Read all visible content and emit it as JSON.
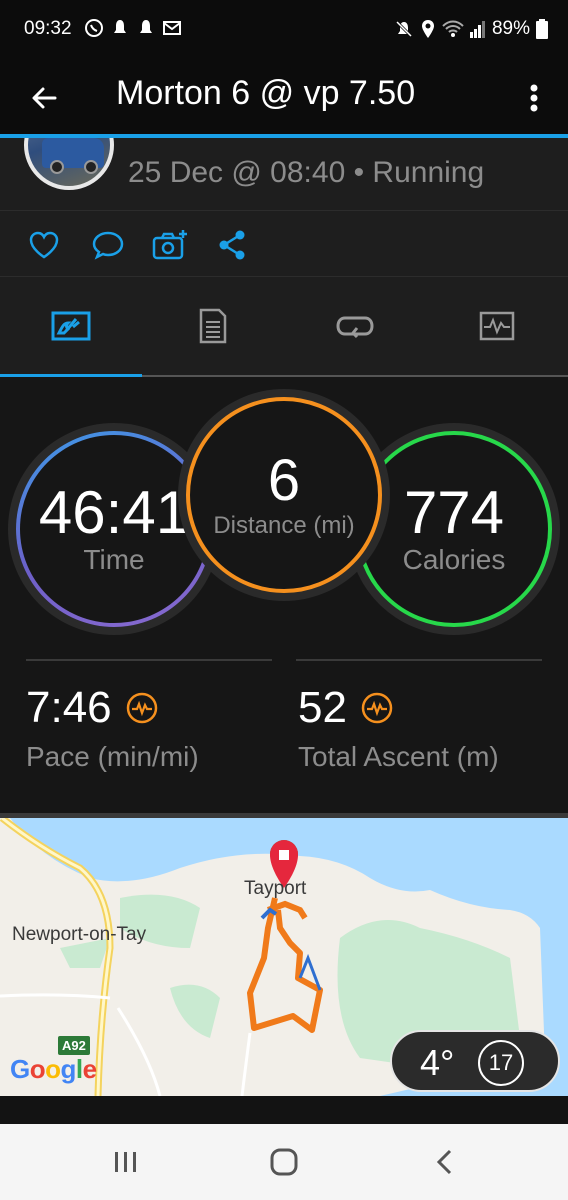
{
  "status_bar": {
    "time": "09:32",
    "battery_percent": "89%",
    "left_icons": [
      "whatsapp-icon",
      "notification-icon",
      "notification-icon",
      "mail-icon"
    ],
    "right_icons": [
      "mute-icon",
      "location-icon",
      "wifi-icon",
      "signal-icon",
      "battery-icon"
    ]
  },
  "app_bar": {
    "title": "Morton 6 @ vp 7.50",
    "back_icon": "arrow-back-icon",
    "menu_icon": "more-vertical-icon"
  },
  "activity": {
    "meta": "25 Dec @ 08:40 • Running"
  },
  "actions": [
    "like-icon",
    "comment-icon",
    "add-photo-icon",
    "share-icon"
  ],
  "tabs": [
    {
      "icon": "overview-icon",
      "active": true
    },
    {
      "icon": "details-icon",
      "active": false
    },
    {
      "icon": "laps-icon",
      "active": false
    },
    {
      "icon": "charts-icon",
      "active": false
    }
  ],
  "stats": {
    "time": {
      "value": "46:41",
      "label": "Time"
    },
    "distance": {
      "value": "6",
      "label": "Distance (mi)"
    },
    "calories": {
      "value": "774",
      "label": "Calories"
    },
    "pace": {
      "value": "7:46",
      "label": "Pace (min/mi)"
    },
    "ascent": {
      "value": "52",
      "label": "Total Ascent (m)"
    }
  },
  "map": {
    "labels": {
      "town1": "Tayport",
      "town2": "Newport-on-Tay",
      "road": "A92",
      "brand": "Google"
    },
    "weather": {
      "temp": "4°",
      "wind": "17"
    }
  },
  "nav": [
    "recents-icon",
    "home-icon",
    "back-icon"
  ],
  "colors": {
    "accent": "#1aa0e8",
    "time_ring": "#6d5fc8",
    "distance_ring": "#f5901e",
    "calories_ring": "#27d84a",
    "route_orange": "#f07a1a"
  }
}
